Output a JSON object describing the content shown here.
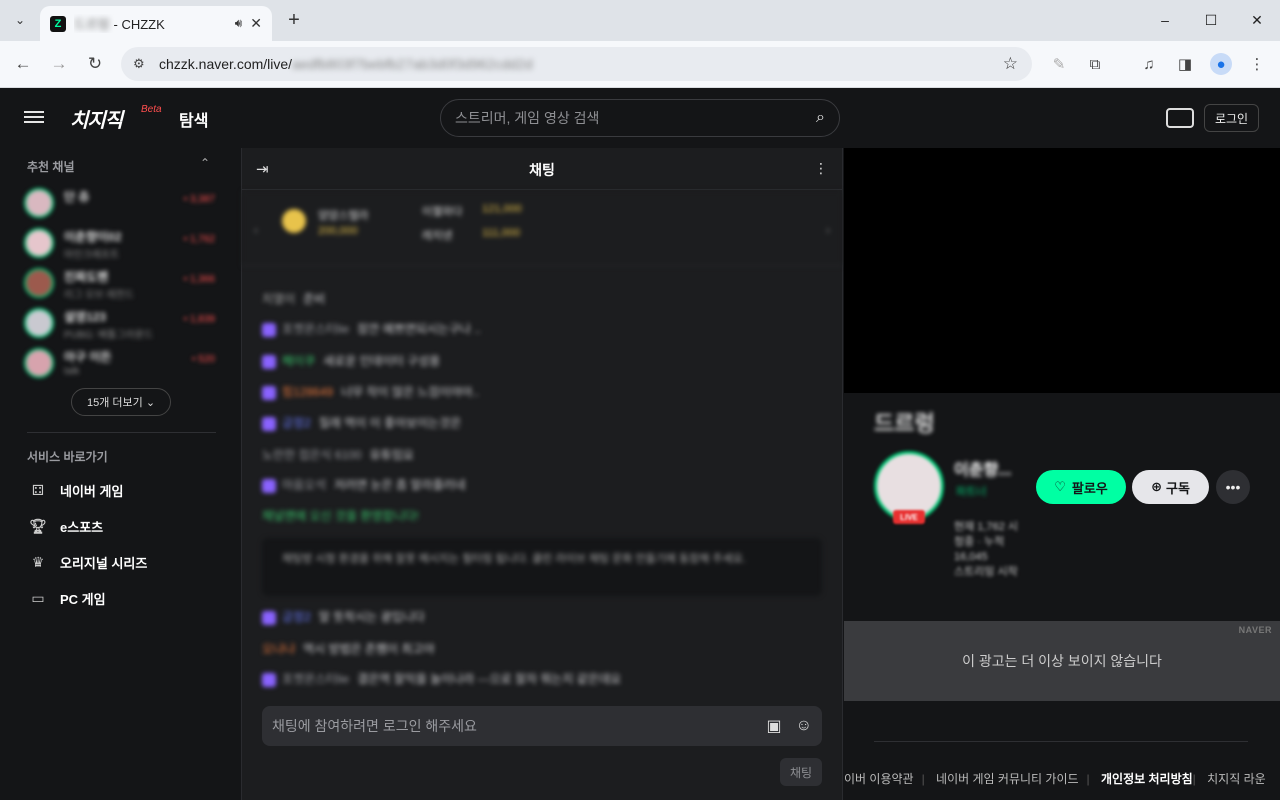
{
  "browser": {
    "tab": {
      "title_blur": "드르렁",
      "title_suffix": " - CHZZK",
      "favicon": "Z"
    },
    "new_tab": "+",
    "url_host": "chzzk.naver.com/live/",
    "url_rest": "aedfb803f7bebfb27ab3d0f3d962cdd2d",
    "window_controls": {
      "minimize": "–",
      "maximize": "☐",
      "close": "✕"
    }
  },
  "header": {
    "logo": "치지직",
    "beta": "Beta",
    "explore": "탐색",
    "search_placeholder": "스트리머, 게임 영상 검색",
    "login": "로그인"
  },
  "sidebar": {
    "recommended_title": "추천 채널",
    "channels": [
      {
        "name": "단 츄",
        "sub": "",
        "viewers": "• 3,387"
      },
      {
        "name": "이춘향이02",
        "sub": "마인크래프트",
        "viewers": "• 1,762"
      },
      {
        "name": "진짜도펜",
        "sub": "리그 오브 레전드",
        "viewers": "• 1,366"
      },
      {
        "name": "설영123",
        "sub": "PUBG: 배틀그라운드",
        "viewers": "• 1,839"
      },
      {
        "name": "아구 이든",
        "sub": "talk",
        "viewers": "• 520"
      }
    ],
    "more": "15개 더보기",
    "services_title": "서비스 바로가기",
    "services": [
      {
        "icon": "game-icon",
        "label": "네이버 게임"
      },
      {
        "icon": "trophy-icon",
        "label": "e스포츠"
      },
      {
        "icon": "crown-icon",
        "label": "오리지널 시리즈"
      },
      {
        "icon": "monitor-icon",
        "label": "PC 게임"
      }
    ]
  },
  "chat": {
    "title": "채팅",
    "donors": [
      {
        "name": "얌얌스텔라",
        "amount": "200,000"
      },
      {
        "name": "이젤와다",
        "amount": "121,000"
      },
      {
        "name": "레치넨",
        "amount": "111,000"
      }
    ],
    "messages": [
      {
        "nick": "치열이",
        "text": "준비",
        "color": "#aaaaaa",
        "badge": false
      },
      {
        "nick": "포켓몬스터lie",
        "text": "잠깐 예쁘면되시는구나 ..",
        "color": "#9a9ba0",
        "badge": true
      },
      {
        "nick": "헤이쿠",
        "text": "새로운 인데이터 구성용",
        "color": "#39c56b",
        "badge": true
      },
      {
        "nick": "힘128649",
        "text": "너무 작이 많은 느낌이야아..",
        "color": "#e8773c",
        "badge": true
      },
      {
        "nick": "긍정2",
        "text": "질래 역이 이 좋아보이는것은",
        "color": "#6a7bff",
        "badge": true
      },
      {
        "nick": "노란한 접은식 6100",
        "text": "유튜임요",
        "color": "#9a9ba0",
        "badge": false
      },
      {
        "nick": "마음오석",
        "text": "저러면 눈은 좀 알라줄러네",
        "color": "#9a9ba0",
        "badge": true
      },
      {
        "nick": "채널맨에 오신 것을 환영합니다!",
        "text": "",
        "color": "#39c56b",
        "badge": false
      },
      {
        "nick": "긍정2",
        "text": "말 뜻착시는 광입니다",
        "color": "#6a7bff",
        "badge": true
      },
      {
        "nick": "오냐냐",
        "text": "역시 방법은 존쨈이 최고야",
        "color": "#e8773c",
        "badge": false
      },
      {
        "nick": "포켓몬스터lie",
        "text": "결은역 잘익을 놀이나라 ---으로 잘자 뭐는지 같은데요",
        "color": "#9a9ba0",
        "badge": true
      }
    ],
    "notice": "채팅방 시청 환경을 위해 잘못 메시지는 필터링 됩니다. 클린 라이브 채팅 문화 만들기에 동참해 주세요.",
    "input_placeholder": "채팅에 참여하려면 로그인 해주세요",
    "send": "채팅"
  },
  "live": {
    "title": "드르렁",
    "live_badge": "LIVE",
    "streamer": "이춘향...",
    "verified": "파트너",
    "info": "현재 1,762 시청중 · 누적 16,045",
    "start": "스트리밍 시작",
    "follow": "팔로우",
    "subscribe": "구독",
    "ad_brand": "NAVER",
    "ad_text": "이 광고는 더 이상 보이지 않습니다",
    "footer": [
      "이버 이용약관",
      "네이버 게임 커뮤니티 가이드",
      "개인정보 처리방침",
      "치지직 라운"
    ]
  }
}
